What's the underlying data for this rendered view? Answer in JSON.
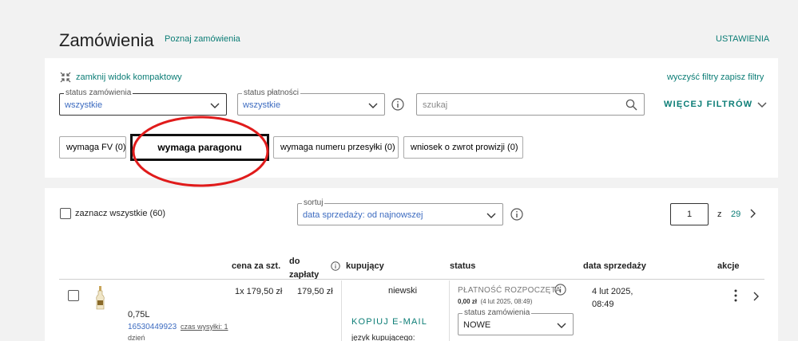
{
  "header": {
    "title": "Zamówienia",
    "learn_link": "Poznaj zamówienia",
    "settings_link": "USTAWIENIA"
  },
  "filters": {
    "compact_toggle": "zamknij widok kompaktowy",
    "clear_filters": "wyczyść filtry",
    "save_filters": "zapisz filtry",
    "order_status": {
      "label": "status zamówienia",
      "value": "wszystkie"
    },
    "payment_status": {
      "label": "status płatności",
      "value": "wszystkie"
    },
    "search_placeholder": "szukaj",
    "more_filters": "WIĘCEJ FILTRÓW",
    "chips": [
      "wymaga FV (0)",
      "wymaga paragonu",
      "wymaga numeru przesyłki (0)",
      "wniosek o zwrot prowizji (0)"
    ]
  },
  "toolbar": {
    "select_all": "zaznacz wszystkie (60)",
    "sort": {
      "label": "sortuj",
      "value": "data sprzedaży: od najnowszej"
    },
    "pagination": {
      "current": "1",
      "of_label": "z",
      "total": "29"
    }
  },
  "table": {
    "headers": {
      "price": "cena za szt.",
      "due": "do zapłaty",
      "buyer": "kupujący",
      "status": "status",
      "date": "data sprzedaży",
      "actions": "akcje"
    },
    "rows": [
      {
        "volume": "0,75L",
        "offer_id": "16530449923",
        "ship_time": "czas wysyłki: 1",
        "ship_time_cont": "dzień",
        "price": "1x 179,50 zł",
        "due": "179,50 zł",
        "buyer": "niewski",
        "copy_email": "KOPIUJ E-MAIL",
        "buyer_lang": "język kupującego:",
        "payment_status": "PŁATNOŚĆ ROZPOCZĘTA",
        "paid_amount": "0,00 zł",
        "paid_date": "(4 lut 2025, 08:49)",
        "order_status": {
          "label": "status zamówienia",
          "value": "NOWE"
        },
        "date": "4 lut 2025, 08:49"
      }
    ]
  },
  "colors": {
    "accent_teal": "#0c7d76",
    "link_blue": "#3c6bc0",
    "highlight_red": "#e01b1b"
  }
}
